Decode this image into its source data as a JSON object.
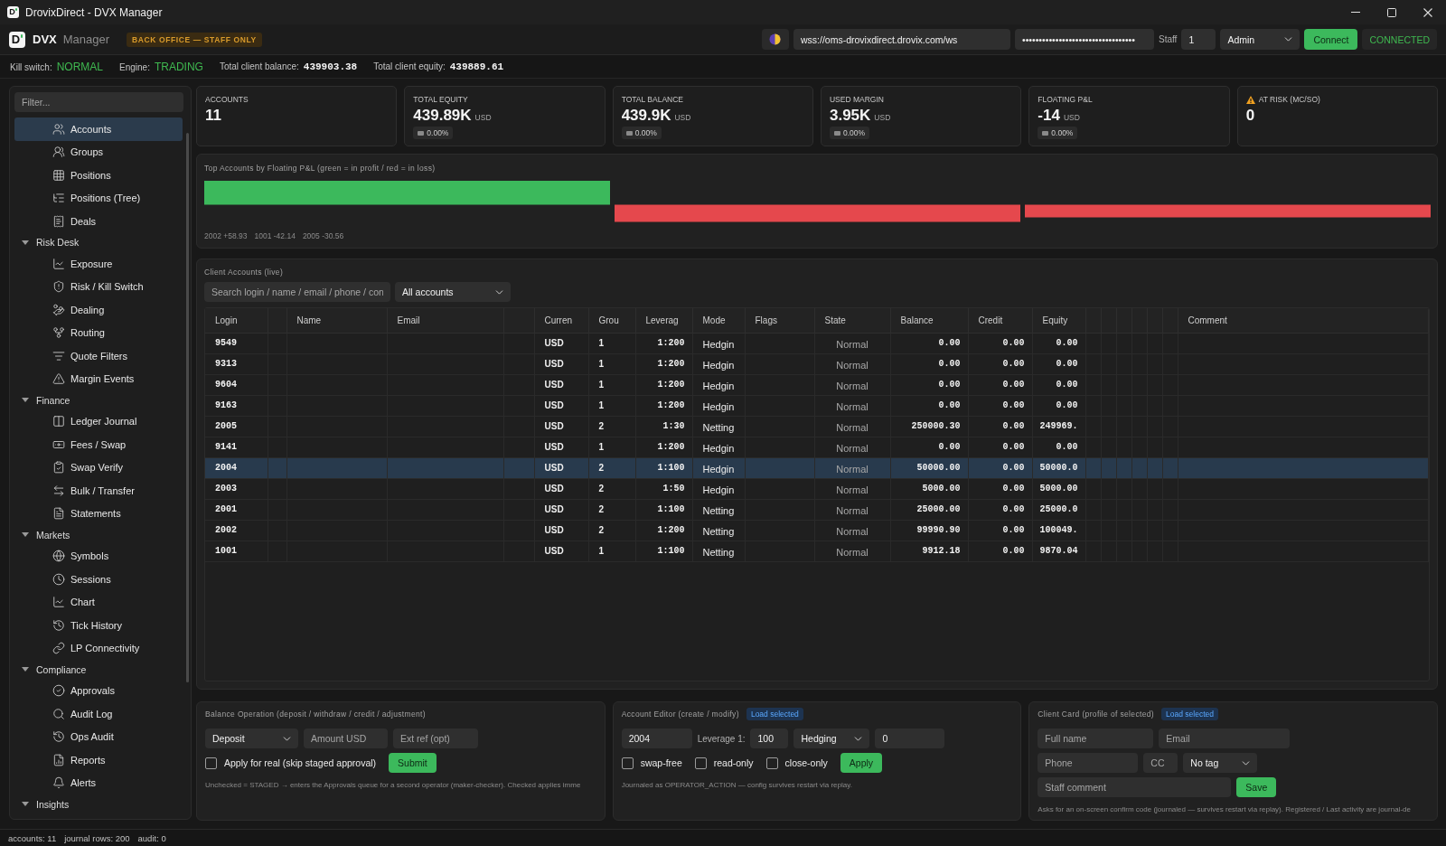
{
  "window": {
    "logo": "D",
    "title": "DrovixDirect - DVX Manager"
  },
  "toolbar": {
    "logo": "D",
    "brand": "DVX",
    "product": "Manager",
    "badge": "BACK OFFICE — STAFF ONLY",
    "server_url": {
      "value": "wss://oms-drovixdirect.drovix.com/ws"
    },
    "token": {
      "value": "••••••••••••••••••••••••••••••••••"
    },
    "staff_label": "Staff",
    "staff_id": {
      "value": "1"
    },
    "role": "Admin",
    "connect_button": "Connect",
    "connection": {
      "status": "CONNECTED",
      "connected": true
    }
  },
  "status_strip": [
    {
      "kind": "status",
      "label": "Kill switch:",
      "value": "NORMAL"
    },
    {
      "kind": "status",
      "label": "Engine:",
      "value": "TRADING"
    },
    {
      "kind": "amount",
      "label": "Total client balance:",
      "value": "439903.38"
    },
    {
      "kind": "amount",
      "label": "Total client equity:",
      "value": "439889.61"
    }
  ],
  "sidebar": {
    "filter": {
      "placeholder": "Filter..."
    },
    "items": [
      {
        "kind": "item",
        "label": "Accounts",
        "selected": true
      },
      {
        "kind": "item",
        "label": "Groups",
        "selected": false
      },
      {
        "kind": "item",
        "label": "Positions",
        "selected": false
      },
      {
        "kind": "item",
        "label": "Positions (Tree)",
        "selected": false
      },
      {
        "kind": "item",
        "label": "Deals",
        "selected": false
      },
      {
        "kind": "group",
        "label": "Risk Desk",
        "expanded": true,
        "children": [
          {
            "label": "Exposure",
            "selected": false
          },
          {
            "label": "Risk / Kill Switch",
            "selected": false
          },
          {
            "label": "Dealing",
            "selected": false
          },
          {
            "label": "Routing",
            "selected": false
          },
          {
            "label": "Quote Filters",
            "selected": false
          },
          {
            "label": "Margin Events",
            "selected": false
          }
        ]
      },
      {
        "kind": "group",
        "label": "Finance",
        "expanded": true,
        "children": [
          {
            "label": "Ledger Journal",
            "selected": false
          },
          {
            "label": "Fees / Swap",
            "selected": false
          },
          {
            "label": "Swap Verify",
            "selected": false
          },
          {
            "label": "Bulk / Transfer",
            "selected": false
          },
          {
            "label": "Statements",
            "selected": false
          }
        ]
      },
      {
        "kind": "group",
        "label": "Markets",
        "expanded": true,
        "children": [
          {
            "label": "Symbols",
            "selected": false
          },
          {
            "label": "Sessions",
            "selected": false
          },
          {
            "label": "Chart",
            "selected": false
          },
          {
            "label": "Tick History",
            "selected": false
          },
          {
            "label": "LP Connectivity",
            "selected": false
          }
        ]
      },
      {
        "kind": "group",
        "label": "Compliance",
        "expanded": true,
        "children": [
          {
            "label": "Approvals",
            "selected": false
          },
          {
            "label": "Audit Log",
            "selected": false
          },
          {
            "label": "Ops Audit",
            "selected": false
          },
          {
            "label": "Reports",
            "selected": false
          },
          {
            "label": "Alerts",
            "selected": false
          }
        ]
      },
      {
        "kind": "group",
        "label": "Insights",
        "expanded": true
      }
    ]
  },
  "stat_cards": [
    {
      "label": "ACCOUNTS",
      "value": "11",
      "warning": false
    },
    {
      "label": "TOTAL EQUITY",
      "value": "439.89K",
      "unit": "USD",
      "change": "0.00%",
      "warning": false
    },
    {
      "label": "TOTAL BALANCE",
      "value": "439.9K",
      "unit": "USD",
      "change": "0.00%",
      "warning": false
    },
    {
      "label": "USED MARGIN",
      "value": "3.95K",
      "unit": "USD",
      "change": "0.00%",
      "warning": false
    },
    {
      "label": "FLOATING P&L",
      "value": "-14",
      "unit": "USD",
      "change": "0.00%",
      "warning": false
    },
    {
      "label": "AT RISK (MC/SO)",
      "value": "0",
      "warning": true
    }
  ],
  "pnl_chart": {
    "title": "Top Accounts by Floating P&L (green = in profit / red = in loss)",
    "legend": [
      "2002 +58.93",
      "1001 -42.14",
      "2005 -30.56"
    ]
  },
  "accounts_panel": {
    "title": "Client Accounts (live)",
    "search": {
      "placeholder": "Search login / name / email / phone / con"
    },
    "filter": "All accounts",
    "table": {
      "columns": [
        {
          "label": "Login"
        },
        {},
        {
          "label": "Name"
        },
        {
          "label": "Email"
        },
        {},
        {
          "label": "Curren"
        },
        {
          "label": "Grou"
        },
        {
          "label": "Leverag"
        },
        {
          "label": "Mode"
        },
        {
          "label": "Flags"
        },
        {
          "label": "State"
        },
        {
          "label": "Balance"
        },
        {
          "label": "Credit"
        },
        {
          "label": "Equity"
        },
        {},
        {},
        {},
        {},
        {},
        {},
        {
          "label": "Comment"
        }
      ],
      "rows": [
        {
          "login": "9549",
          "column_6": "USD",
          "column_7": "1",
          "column_8": "1:200",
          "mode": "Hedgin",
          "state": "Normal",
          "balance": "0.00",
          "credit": "0.00",
          "equity": "0.00",
          "selected": false
        },
        {
          "login": "9313",
          "column_6": "USD",
          "column_7": "1",
          "column_8": "1:200",
          "mode": "Hedgin",
          "state": "Normal",
          "balance": "0.00",
          "credit": "0.00",
          "equity": "0.00",
          "selected": false
        },
        {
          "login": "9604",
          "column_6": "USD",
          "column_7": "1",
          "column_8": "1:200",
          "mode": "Hedgin",
          "state": "Normal",
          "balance": "0.00",
          "credit": "0.00",
          "equity": "0.00",
          "selected": false
        },
        {
          "login": "9163",
          "column_6": "USD",
          "column_7": "1",
          "column_8": "1:200",
          "mode": "Hedgin",
          "state": "Normal",
          "balance": "0.00",
          "credit": "0.00",
          "equity": "0.00",
          "selected": false
        },
        {
          "login": "2005",
          "column_6": "USD",
          "column_7": "2",
          "column_8": "1:30",
          "mode": "Netting",
          "state": "Normal",
          "balance": "250000.30",
          "credit": "0.00",
          "equity": "249969.",
          "selected": false
        },
        {
          "login": "9141",
          "column_6": "USD",
          "column_7": "1",
          "column_8": "1:200",
          "mode": "Hedgin",
          "state": "Normal",
          "balance": "0.00",
          "credit": "0.00",
          "equity": "0.00",
          "selected": false
        },
        {
          "login": "2004",
          "column_6": "USD",
          "column_7": "2",
          "column_8": "1:100",
          "mode": "Hedgin",
          "state": "Normal",
          "balance": "50000.00",
          "credit": "0.00",
          "equity": "50000.0",
          "selected": true
        },
        {
          "login": "2003",
          "column_6": "USD",
          "column_7": "2",
          "column_8": "1:50",
          "mode": "Hedgin",
          "state": "Normal",
          "balance": "5000.00",
          "credit": "0.00",
          "equity": "5000.00",
          "selected": false
        },
        {
          "login": "2001",
          "column_6": "USD",
          "column_7": "2",
          "column_8": "1:100",
          "mode": "Netting",
          "state": "Normal",
          "balance": "25000.00",
          "credit": "0.00",
          "equity": "25000.0",
          "selected": false
        },
        {
          "login": "2002",
          "column_6": "USD",
          "column_7": "2",
          "column_8": "1:200",
          "mode": "Netting",
          "state": "Normal",
          "balance": "99990.90",
          "credit": "0.00",
          "equity": "100049.",
          "selected": false
        },
        {
          "login": "1001",
          "column_6": "USD",
          "column_7": "1",
          "column_8": "1:100",
          "mode": "Netting",
          "state": "Normal",
          "balance": "9912.18",
          "credit": "0.00",
          "equity": "9870.04",
          "selected": false
        }
      ]
    }
  },
  "balance_operation": {
    "title": "Balance Operation (deposit / withdraw / credit / adjustment)",
    "operation": "Deposit",
    "amount": {
      "placeholder": "Amount USD"
    },
    "ext_ref": {
      "placeholder": "Ext ref (opt)"
    },
    "apply_for_real": {
      "label": "Apply for real (skip staged approval)",
      "checked": false
    },
    "submit_button": "Submit",
    "note": "Unchecked = STAGED → enters the Approvals queue for a second operator (maker-checker). Checked applies imme"
  },
  "account_editor": {
    "title": "Account Editor (create / modify)",
    "load_button": "Load selected",
    "login": {
      "value": "2004"
    },
    "leverage_label": "Leverage 1:",
    "leverage": {
      "value": "100"
    },
    "mode": "Hedging",
    "field_5": {
      "value": "0"
    },
    "options": [
      {
        "label": "swap-free",
        "checked": false
      },
      {
        "label": "read-only",
        "checked": false
      },
      {
        "label": "close-only",
        "checked": false
      }
    ],
    "apply_button": "Apply",
    "note": "Journaled as OPERATOR_ACTION — config survives restart via replay."
  },
  "client_card": {
    "title": "Client Card (profile of selected)",
    "load_button": "Load selected",
    "full_name": {
      "placeholder": "Full name"
    },
    "email": {
      "placeholder": "Email"
    },
    "phone": {
      "placeholder": "Phone"
    },
    "cc": {
      "placeholder": "CC"
    },
    "tag": "No tag",
    "staff_comment": {
      "placeholder": "Staff comment"
    },
    "save_button": "Save",
    "note": "Asks for an on-screen confirm code (journaled — survives restart via replay). Registered / Last activity are journal-de"
  },
  "status_bar": [
    "accounts: 11",
    "journal rows: 200",
    "audit: 0"
  ]
}
